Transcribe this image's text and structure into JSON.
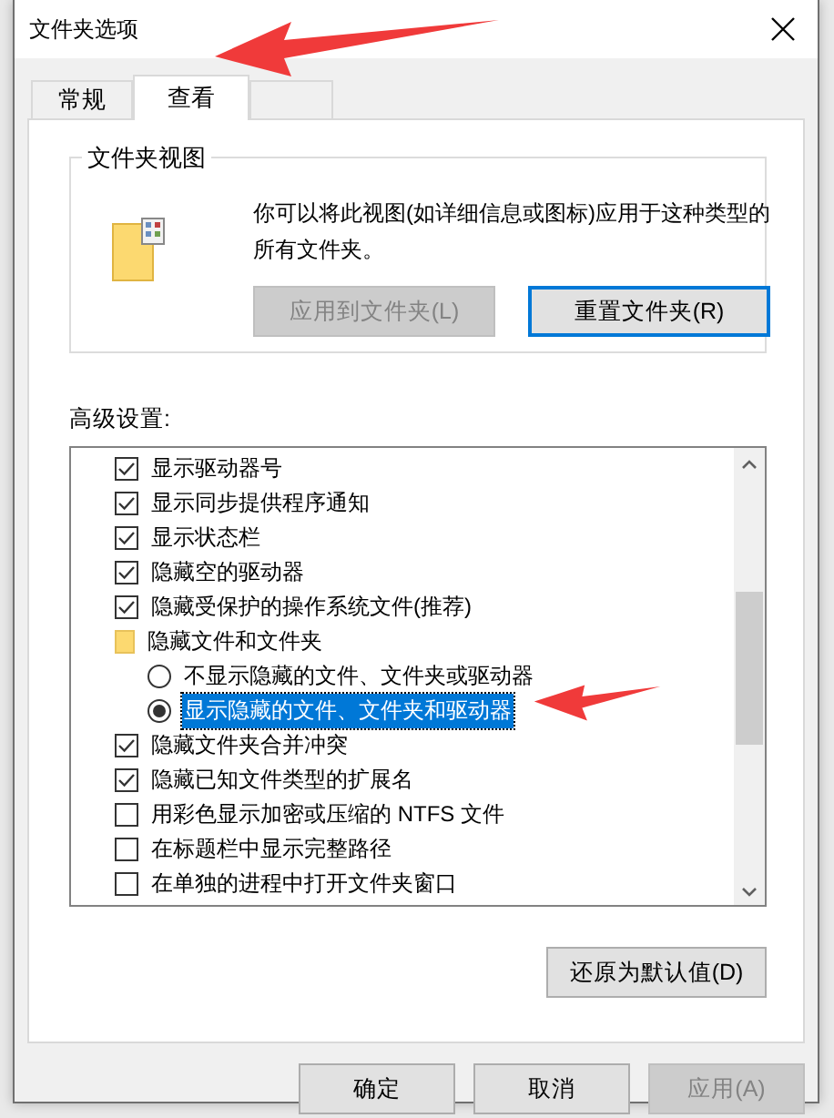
{
  "window": {
    "title": "文件夹选项"
  },
  "tabs": [
    {
      "label": "常规",
      "selected": false
    },
    {
      "label": "查看",
      "selected": true
    },
    {
      "selected": false
    }
  ],
  "folder_views": {
    "title": "文件夹视图",
    "description": "你可以将此视图(如详细信息或图标)应用于这种类型的所有文件夹。",
    "buttons": [
      {
        "label": "应用到文件夹(L)",
        "disabled": true,
        "default": false
      },
      {
        "label": "重置文件夹(R)",
        "disabled": false,
        "default": true
      }
    ]
  },
  "advanced": {
    "label": "高级设置:",
    "items": [
      {
        "kind": "checkbox",
        "label": "显示驱动器号",
        "checked": true
      },
      {
        "kind": "checkbox",
        "label": "显示同步提供程序通知",
        "checked": true
      },
      {
        "kind": "checkbox",
        "label": "显示状态栏",
        "checked": true
      },
      {
        "kind": "checkbox",
        "label": "隐藏空的驱动器",
        "checked": true
      },
      {
        "kind": "checkbox",
        "label": "隐藏受保护的操作系统文件(推荐)",
        "checked": true
      },
      {
        "kind": "folder",
        "label": "隐藏文件和文件夹",
        "children": [
          {
            "kind": "radio",
            "label": "不显示隐藏的文件、文件夹或驱动器",
            "selected": false
          },
          {
            "kind": "radio",
            "label": "显示隐藏的文件、文件夹和驱动器",
            "selected": true
          }
        ]
      },
      {
        "kind": "checkbox",
        "label": "隐藏文件夹合并冲突",
        "checked": true
      },
      {
        "kind": "checkbox",
        "label": "隐藏已知文件类型的扩展名",
        "checked": true
      },
      {
        "kind": "checkbox",
        "label": "用彩色显示加密或压缩的 NTFS 文件",
        "checked": false
      },
      {
        "kind": "checkbox",
        "label": "在标题栏中显示完整路径",
        "checked": false
      },
      {
        "kind": "checkbox",
        "label": "在单独的进程中打开文件夹窗口",
        "checked": false
      }
    ],
    "restore_button": "还原为默认值(D)"
  },
  "buttons": [
    {
      "label": "确定",
      "disabled": false
    },
    {
      "label": "取消",
      "disabled": false
    },
    {
      "label": "应用(A)",
      "disabled": true
    }
  ]
}
